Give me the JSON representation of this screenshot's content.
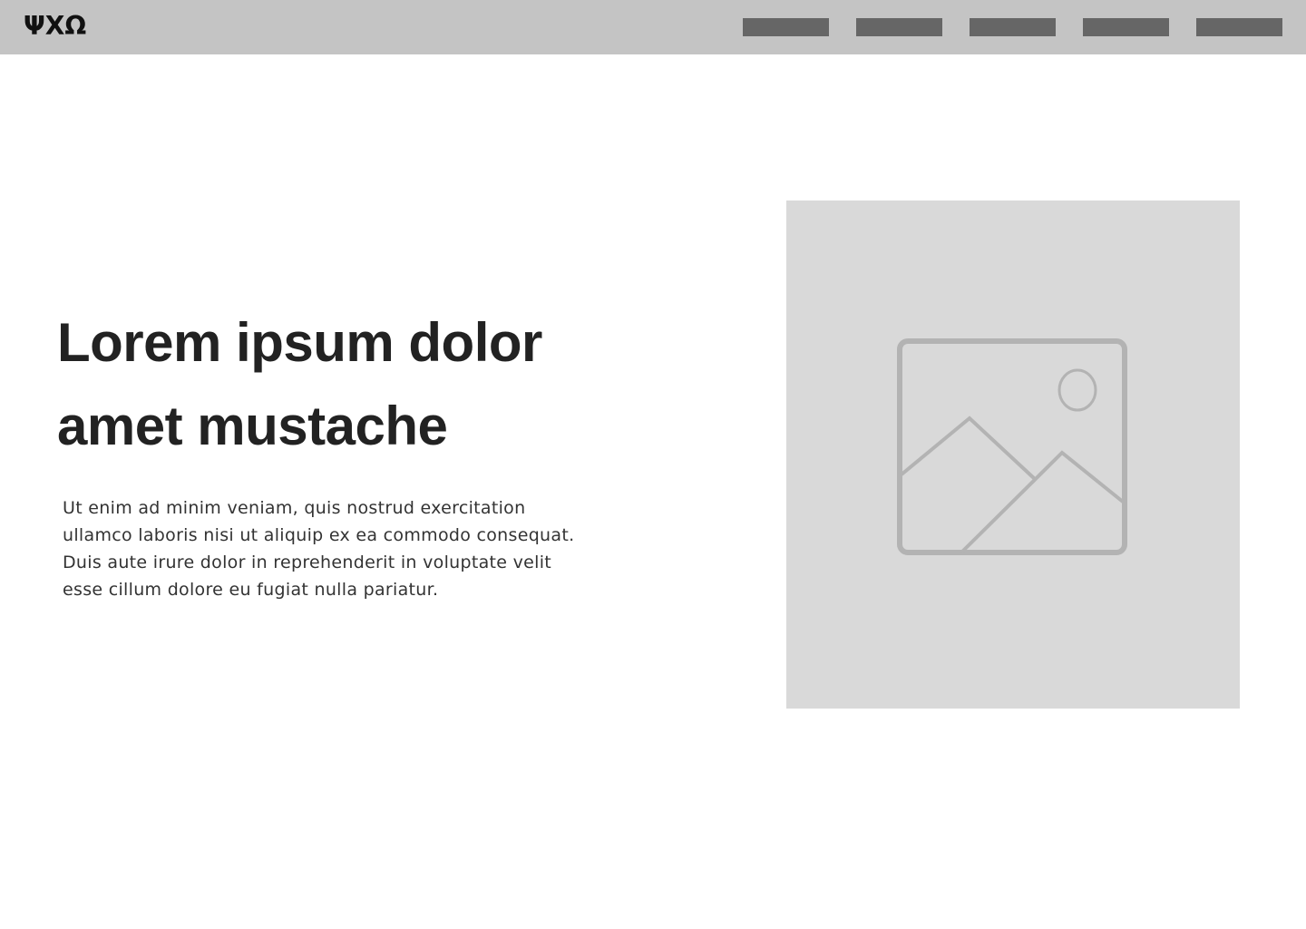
{
  "header": {
    "logo": "ΨΧΩ",
    "nav_items": [
      "",
      "",
      "",
      "",
      ""
    ]
  },
  "hero": {
    "title_lines": [
      "Lorem ipsum dolor",
      "amet mustache"
    ],
    "body_lines": [
      "Ut enim ad minim veniam, quis nostrud exercitation",
      "ullamco laboris nisi ut aliquip ex ea commodo consequat.",
      "Duis aute irure dolor in reprehenderit in voluptate velit",
      "esse cillum dolore eu fugiat nulla pariatur."
    ],
    "image_icon": "image-icon"
  },
  "colors": {
    "topbar": "#c4c4c4",
    "nav_item": "#666666",
    "placeholder": "#d9d9d9",
    "icon_stroke": "#b3b3b3",
    "title": "#222222"
  }
}
